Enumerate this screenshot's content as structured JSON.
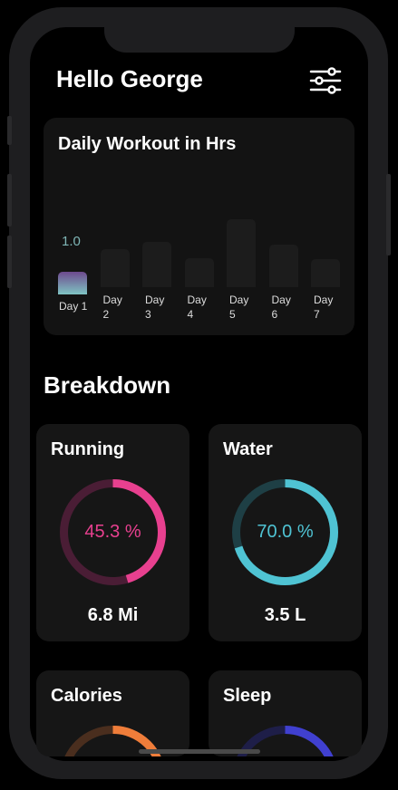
{
  "header": {
    "greeting": "Hello George",
    "filter_icon": "sliders-icon"
  },
  "workout": {
    "title": "Daily Workout in Hrs",
    "selected_value": "1.0",
    "chart_data": {
      "type": "bar",
      "categories": [
        "Day 1",
        "Day 2",
        "Day 3",
        "Day 4",
        "Day 5",
        "Day 6",
        "Day 7"
      ],
      "values": [
        1.0,
        1.7,
        2.0,
        1.3,
        3.0,
        1.9,
        1.25
      ],
      "selected": "Day 1",
      "colors": {
        "selected_top": "#6d4a8e",
        "selected_bottom": "#7fc4c3",
        "inactive": "#1c1c1c"
      }
    }
  },
  "breakdown": {
    "title": "Breakdown",
    "cards": [
      {
        "title": "Running",
        "percent_label": "45.3 %",
        "fraction": 0.453,
        "value": "6.8 Mi",
        "color": "#e8408f",
        "track": "#4a1d35"
      },
      {
        "title": "Water",
        "percent_label": "70.0 %",
        "fraction": 0.7,
        "value": "3.5 L",
        "color": "#4fc3d3",
        "track": "#1e3f45"
      },
      {
        "title": "Calories",
        "fraction": 0.4,
        "color": "#ef7d3a",
        "track": "#4a2e1e"
      },
      {
        "title": "Sleep",
        "fraction": 0.4,
        "color": "#4040d0",
        "track": "#1e1e48"
      }
    ]
  }
}
